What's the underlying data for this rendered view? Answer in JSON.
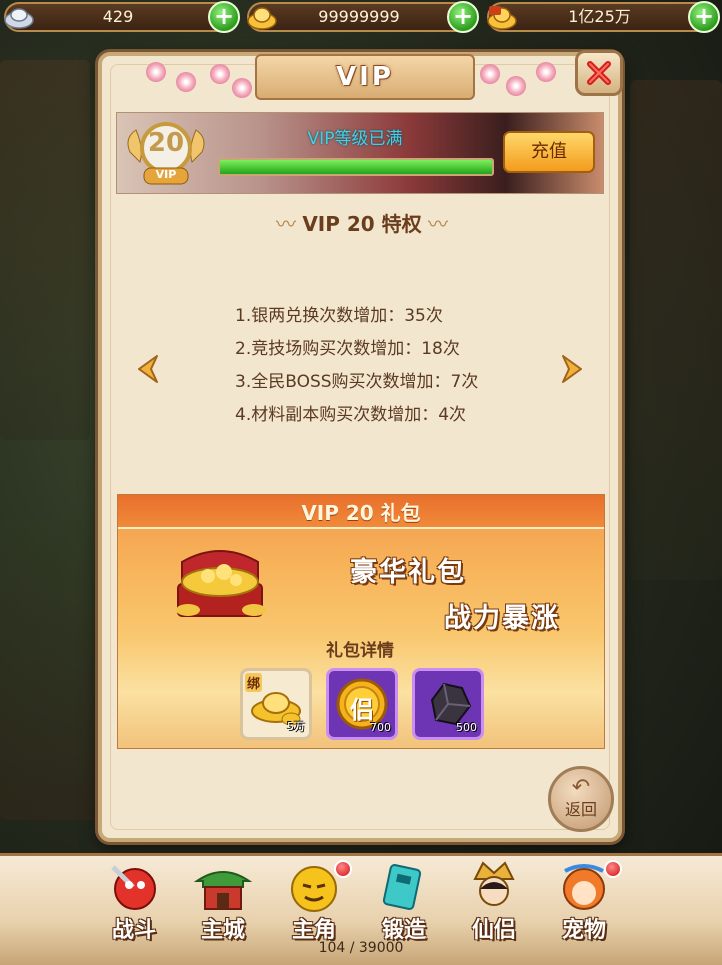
{
  "currencies": [
    {
      "name": "silver",
      "value": "429",
      "icon": "silver-ingot-icon"
    },
    {
      "name": "gold",
      "value": "99999999",
      "icon": "gold-ingot-icon"
    },
    {
      "name": "bound-gold",
      "value": "1亿25万",
      "icon": "bound-gold-icon"
    }
  ],
  "panel": {
    "title": "VIP",
    "vip_level": "20",
    "vip_badge_text": "VIP",
    "status": "VIP等级已满",
    "progress": 1.0,
    "recharge_label": "充值",
    "privilege_title": "VIP 20 特权",
    "privileges": [
      "1.银两兑换次数增加：35次",
      "2.竞技场购买次数增加：18次",
      "3.全民BOSS购买次数增加：7次",
      "4.材料副本购买次数增加：4次"
    ],
    "gift": {
      "title": "VIP 20 礼包",
      "slogan1": "豪华礼包",
      "slogan2": "战力暴涨",
      "detail_label": "礼包详情",
      "items": [
        {
          "tag": "绑",
          "qty": "5万",
          "icon": "gold-ingots-icon"
        },
        {
          "tag": "",
          "qty": "700",
          "icon": "companion-coin-icon",
          "coin_char": "侣"
        },
        {
          "tag": "",
          "qty": "500",
          "icon": "dark-crystal-icon"
        }
      ]
    },
    "back_label": "返回"
  },
  "nav": [
    {
      "label": "战斗",
      "icon": "battle-icon",
      "badge": false
    },
    {
      "label": "主城",
      "icon": "main-city-icon",
      "badge": false
    },
    {
      "label": "主角",
      "icon": "hero-icon",
      "badge": true
    },
    {
      "label": "锻造",
      "icon": "forge-icon",
      "badge": false
    },
    {
      "label": "仙侣",
      "icon": "immortal-companion-icon",
      "badge": false
    },
    {
      "label": "宠物",
      "icon": "pet-icon",
      "badge": true
    }
  ],
  "exp_text": "104 / 39000",
  "colors": {
    "accent": "#f39c1c",
    "panel": "#f3e6cf",
    "status_text": "#3fd2e8",
    "progress": "#22a51a"
  }
}
